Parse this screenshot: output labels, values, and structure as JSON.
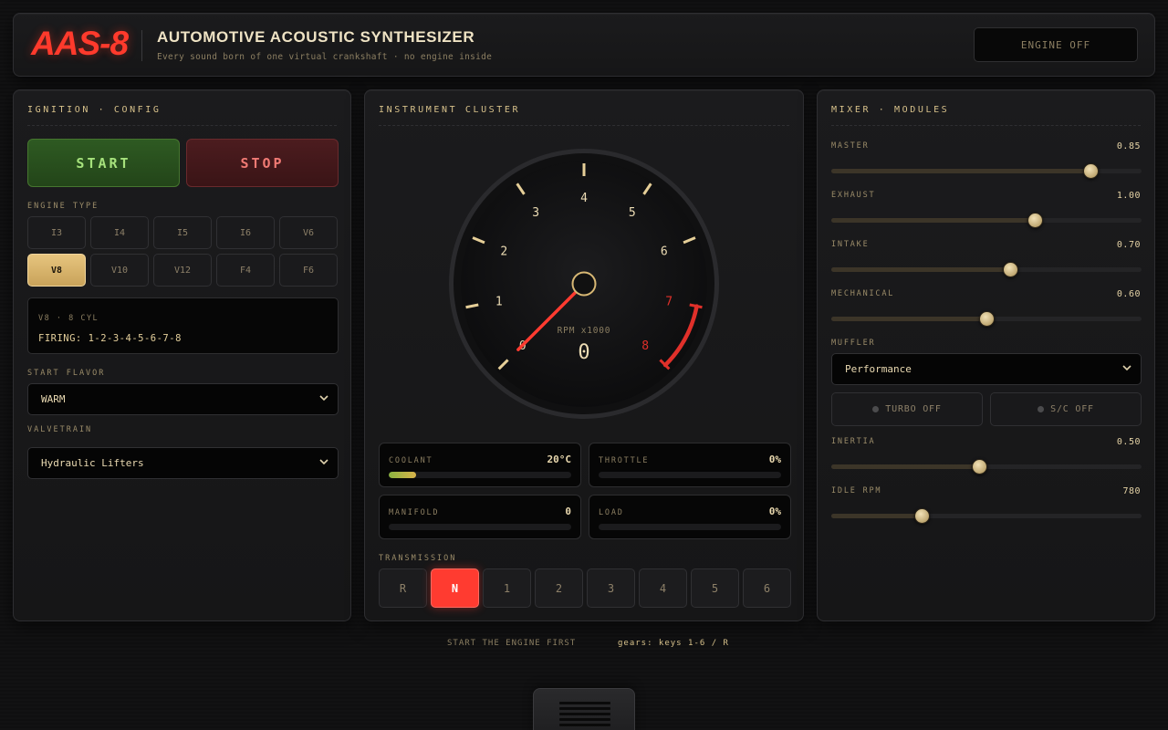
{
  "header": {
    "logo": "AAS-8",
    "title": "AUTOMOTIVE ACOUSTIC SYNTHESIZER",
    "subtitle": "Every sound born of one virtual crankshaft · no engine inside",
    "engine_status": "ENGINE OFF"
  },
  "left": {
    "title": "IGNITION · CONFIG",
    "start_label": "START",
    "stop_label": "STOP",
    "engine_type_label": "ENGINE TYPE",
    "engine_types": [
      "I3",
      "I4",
      "I5",
      "I6",
      "V6",
      "V8",
      "V10",
      "V12",
      "F4",
      "F6"
    ],
    "selected_engine": "V8",
    "engine_info": {
      "sub": "V8 · 8 CYL",
      "firing": "FIRING: 1-2-3-4-5-6-7-8"
    },
    "start_flavor_label": "START FLAVOR",
    "start_flavor_value": "WARM",
    "valvetrain_label": "VALVETRAIN",
    "valvetrain_value": "Hydraulic Lifters"
  },
  "center": {
    "title": "INSTRUMENT CLUSTER",
    "gauge": {
      "unit_label": "RPM x1000",
      "value": "0",
      "tick_labels": [
        "0",
        "1",
        "2",
        "3",
        "4",
        "5",
        "6",
        "7",
        "8"
      ],
      "redline_from": 7,
      "max": 8,
      "needle_rpm": 0
    },
    "readouts": [
      {
        "label": "COOLANT",
        "value": "20°C",
        "fill": 0.15
      },
      {
        "label": "THROTTLE",
        "value": "0%",
        "fill": 0
      },
      {
        "label": "MANIFOLD",
        "value": "0",
        "fill": 0
      },
      {
        "label": "LOAD",
        "value": "0%",
        "fill": 0
      }
    ],
    "transmission_label": "TRANSMISSION",
    "gears": [
      "R",
      "N",
      "1",
      "2",
      "3",
      "4",
      "5",
      "6"
    ],
    "selected_gear": "N"
  },
  "right": {
    "title": "MIXER · MODULES",
    "sliders": [
      {
        "label": "MASTER",
        "value": "0.85",
        "level": 0.835
      },
      {
        "label": "EXHAUST",
        "value": "1.00",
        "level": 0.655
      },
      {
        "label": "INTAKE",
        "value": "0.70",
        "level": 0.575
      },
      {
        "label": "MECHANICAL",
        "value": "0.60",
        "level": 0.5
      }
    ],
    "muffler_label": "MUFFLER",
    "muffler_value": "Performance",
    "turbo_label": "TURBO OFF",
    "sc_label": "S/C OFF",
    "sliders2": [
      {
        "label": "INERTIA",
        "value": "0.50",
        "level": 0.475
      },
      {
        "label": "IDLE RPM",
        "value": "780",
        "level": 0.29
      }
    ]
  },
  "footer": {
    "hint": "START THE ENGINE FIRST",
    "keys": "gears: keys 1-6 / R"
  },
  "colors": {
    "accent_red": "#ff3b30",
    "accent_gold": "#e6c47e",
    "start_green": "#a6e27c"
  }
}
